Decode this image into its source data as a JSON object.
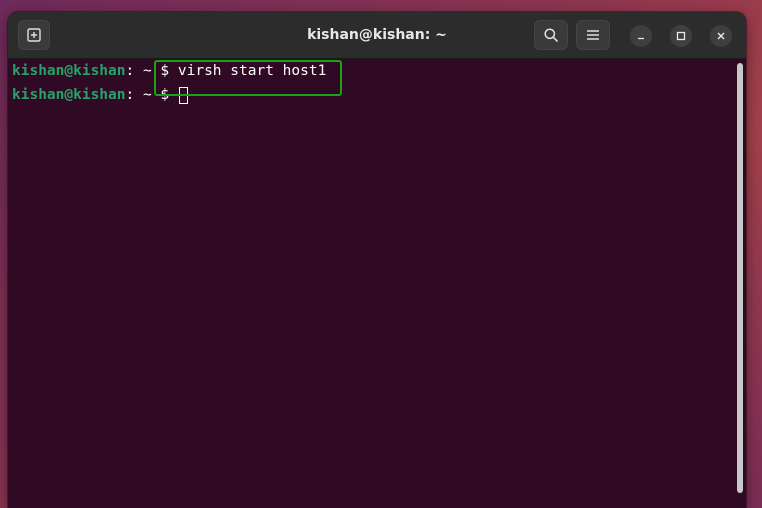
{
  "window": {
    "title": "kishan@kishan: ~"
  },
  "terminal": {
    "lines": [
      {
        "user_host": "kishan@kishan",
        "separator": ":",
        "path": " ~ $ ",
        "command": "virsh start host1"
      },
      {
        "user_host": "kishan@kishan",
        "separator": ":",
        "path": " ~ $ ",
        "command": ""
      }
    ]
  },
  "colors": {
    "terminal_bg": "#300a24",
    "prompt_user": "#26a269",
    "highlight_box": "#1aa11a",
    "titlebar": "#2c2c2c"
  },
  "icons": {
    "new_tab": "new-tab-icon",
    "search": "search-icon",
    "menu": "hamburger-menu-icon",
    "minimize": "minimize-icon",
    "maximize": "maximize-icon",
    "close": "close-icon"
  }
}
